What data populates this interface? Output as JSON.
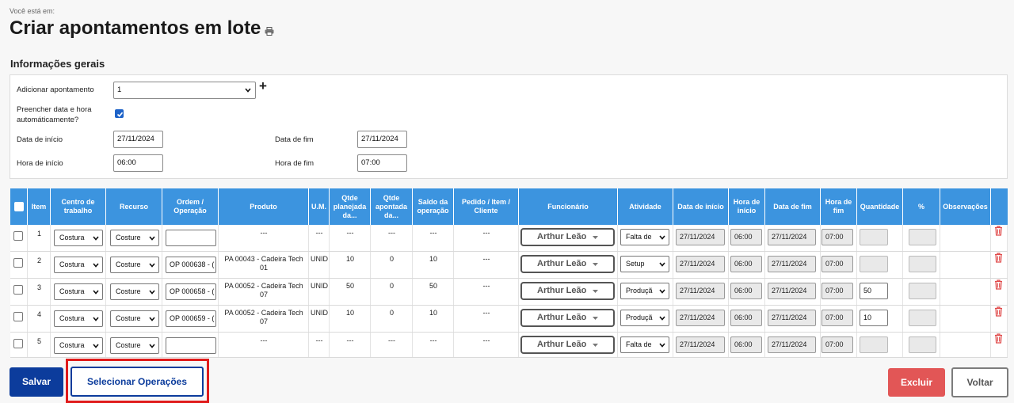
{
  "page": {
    "breadcrumb": "Você está em:",
    "title": "Criar apontamentos em lote"
  },
  "general": {
    "section_title": "Informações gerais",
    "add_label": "Adicionar apontamento",
    "add_value": "1",
    "auto_fill_label_1": "Preencher data e hora",
    "auto_fill_label_2": "automáticamente?",
    "auto_fill_checked": true,
    "start_date_label": "Data de início",
    "start_date_value": "27/11/2024",
    "end_date_label": "Data de fim",
    "end_date_value": "27/11/2024",
    "start_time_label": "Hora de início",
    "start_time_value": "06:00",
    "end_time_label": "Hora de fim",
    "end_time_value": "07:00"
  },
  "table": {
    "headers": {
      "item": "Item",
      "centro": "Centro de trabalho",
      "recurso": "Recurso",
      "ordem": "Ordem / Operação",
      "produto": "Produto",
      "um": "U.M.",
      "qtde_plan": "Qtde planejada da...",
      "qtde_apont": "Qtde apontada da...",
      "saldo": "Saldo da operação",
      "pedido": "Pedido / Item / Cliente",
      "funcionario": "Funcionário",
      "atividade": "Atividade",
      "data_inicio": "Data de início",
      "hora_inicio": "Hora de início",
      "data_fim": "Data de fim",
      "hora_fim": "Hora de fim",
      "quantidade": "Quantidade",
      "percent": "%",
      "obs": "Observações"
    },
    "rows": [
      {
        "item": "1",
        "centro": "Costura",
        "recurso": "Costure",
        "ordem": "",
        "produto_1": "---",
        "produto_2": "",
        "um": "---",
        "qtde_plan": "---",
        "qtde_apont": "---",
        "saldo": "---",
        "pedido": "---",
        "funcionario": "Arthur Leão",
        "atividade": "Falta de",
        "data_inicio": "27/11/2024",
        "hora_inicio": "06:00",
        "data_fim": "27/11/2024",
        "hora_fim": "07:00",
        "quantidade": ""
      },
      {
        "item": "2",
        "centro": "Costura",
        "recurso": "Costure",
        "ordem": "OP 000638 - (",
        "produto_1": "PA 00043 - Cadeira Tech",
        "produto_2": "01",
        "um": "UNID",
        "qtde_plan": "10",
        "qtde_apont": "0",
        "saldo": "10",
        "pedido": "---",
        "funcionario": "Arthur Leão",
        "atividade": "Setup",
        "data_inicio": "27/11/2024",
        "hora_inicio": "06:00",
        "data_fim": "27/11/2024",
        "hora_fim": "07:00",
        "quantidade": ""
      },
      {
        "item": "3",
        "centro": "Costura",
        "recurso": "Costure",
        "ordem": "OP 000658 - (",
        "produto_1": "PA 00052 - Cadeira Tech",
        "produto_2": "07",
        "um": "UNID",
        "qtde_plan": "50",
        "qtde_apont": "0",
        "saldo": "50",
        "pedido": "---",
        "funcionario": "Arthur Leão",
        "atividade": "Produçã",
        "data_inicio": "27/11/2024",
        "hora_inicio": "06:00",
        "data_fim": "27/11/2024",
        "hora_fim": "07:00",
        "quantidade": "50"
      },
      {
        "item": "4",
        "centro": "Costura",
        "recurso": "Costure",
        "ordem": "OP 000659 - (",
        "produto_1": "PA 00052 - Cadeira Tech",
        "produto_2": "07",
        "um": "UNID",
        "qtde_plan": "10",
        "qtde_apont": "0",
        "saldo": "10",
        "pedido": "---",
        "funcionario": "Arthur Leão",
        "atividade": "Produçã",
        "data_inicio": "27/11/2024",
        "hora_inicio": "06:00",
        "data_fim": "27/11/2024",
        "hora_fim": "07:00",
        "quantidade": "10"
      },
      {
        "item": "5",
        "centro": "Costura",
        "recurso": "Costure",
        "ordem": "",
        "produto_1": "---",
        "produto_2": "",
        "um": "---",
        "qtde_plan": "---",
        "qtde_apont": "---",
        "saldo": "---",
        "pedido": "---",
        "funcionario": "Arthur Leão",
        "atividade": "Falta de",
        "data_inicio": "27/11/2024",
        "hora_inicio": "06:00",
        "data_fim": "27/11/2024",
        "hora_fim": "07:00",
        "quantidade": ""
      }
    ]
  },
  "buttons": {
    "save": "Salvar",
    "select_ops": "Selecionar Operações",
    "delete": "Excluir",
    "back": "Voltar"
  },
  "colors": {
    "header_blue": "#3c94df",
    "primary": "#0c3c9c",
    "danger": "#e25656",
    "highlight": "#e01b1b"
  }
}
